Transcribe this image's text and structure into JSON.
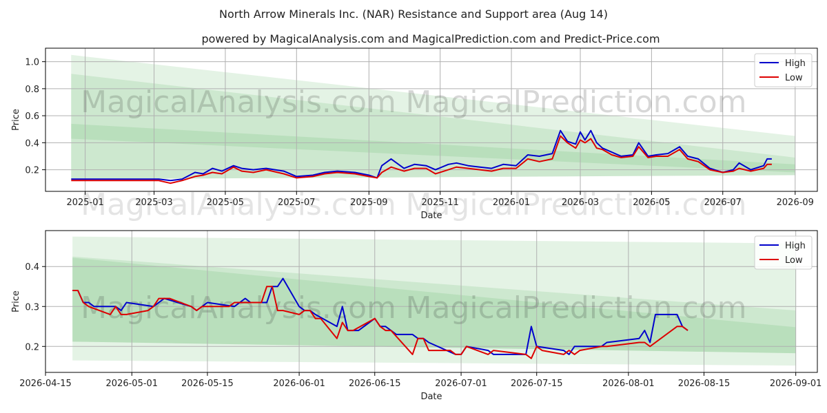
{
  "title": "North Arrow Minerals Inc. (NAR) Resistance and Support area (Aug 14)",
  "subtitle": "powered by MagicalAnalysis.com and MagicalPrediction.com and Predict-Price.com",
  "watermark_left": "MagicalAnalysis.com",
  "watermark_right": "MagicalPrediction.com",
  "colors": {
    "high": "#0000cc",
    "low": "#dd0000",
    "band": "#4caf50",
    "grid": "#b0b0b0"
  },
  "chart_data": [
    {
      "type": "line",
      "xlabel": "Date",
      "ylabel": "Price",
      "xlim": [
        "2024-11-28",
        "2026-09-20"
      ],
      "ylim": [
        0.04,
        1.1
      ],
      "x_ticks": [
        "2025-01",
        "2025-03",
        "2025-05",
        "2025-07",
        "2025-09",
        "2025-11",
        "2026-01",
        "2026-03",
        "2026-05",
        "2026-07",
        "2026-09"
      ],
      "x_tick_dates": [
        "2025-01-01",
        "2025-03-01",
        "2025-05-01",
        "2025-07-01",
        "2025-09-01",
        "2025-11-01",
        "2026-01-01",
        "2026-03-01",
        "2026-05-01",
        "2026-07-01",
        "2026-09-01"
      ],
      "y_ticks": [
        0.2,
        0.4,
        0.6,
        0.8,
        1.0
      ],
      "y_tick_labels": [
        "0.2",
        "0.4",
        "0.6",
        "0.8",
        "1.0"
      ],
      "grid": true,
      "legend": "top-right",
      "bands": [
        {
          "x": [
            "2024-12-20",
            "2026-09-01"
          ],
          "upper": [
            1.05,
            0.45
          ],
          "lower": [
            0.13,
            0.16
          ]
        },
        {
          "x": [
            "2024-12-20",
            "2026-09-01"
          ],
          "upper": [
            0.91,
            0.29
          ],
          "lower": [
            0.13,
            0.16
          ]
        },
        {
          "x": [
            "2024-12-20",
            "2026-09-01"
          ],
          "upper": [
            0.54,
            0.24
          ],
          "lower": [
            0.43,
            0.18
          ]
        }
      ],
      "series": [
        {
          "name": "High",
          "color": "#0000cc",
          "x": [
            "2024-12-20",
            "2025-01-05",
            "2025-01-20",
            "2025-02-05",
            "2025-02-20",
            "2025-03-05",
            "2025-03-15",
            "2025-03-25",
            "2025-04-05",
            "2025-04-12",
            "2025-04-20",
            "2025-04-28",
            "2025-05-08",
            "2025-05-15",
            "2025-05-25",
            "2025-06-05",
            "2025-06-20",
            "2025-07-01",
            "2025-07-15",
            "2025-07-25",
            "2025-08-05",
            "2025-08-20",
            "2025-09-01",
            "2025-09-08",
            "2025-09-12",
            "2025-09-20",
            "2025-10-01",
            "2025-10-10",
            "2025-10-20",
            "2025-10-28",
            "2025-11-08",
            "2025-11-15",
            "2025-11-25",
            "2025-12-05",
            "2025-12-15",
            "2025-12-25",
            "2026-01-05",
            "2026-01-15",
            "2026-01-25",
            "2026-02-05",
            "2026-02-12",
            "2026-02-18",
            "2026-02-25",
            "2026-03-01",
            "2026-03-05",
            "2026-03-10",
            "2026-03-15",
            "2026-03-20",
            "2026-03-28",
            "2026-04-05",
            "2026-04-15",
            "2026-04-20",
            "2026-04-28",
            "2026-05-05",
            "2026-05-15",
            "2026-05-25",
            "2026-06-01",
            "2026-06-10",
            "2026-06-20",
            "2026-07-01",
            "2026-07-10",
            "2026-07-15",
            "2026-07-25",
            "2026-08-05",
            "2026-08-08",
            "2026-08-12"
          ],
          "values": [
            0.13,
            0.13,
            0.13,
            0.13,
            0.13,
            0.13,
            0.12,
            0.13,
            0.18,
            0.17,
            0.21,
            0.19,
            0.23,
            0.21,
            0.2,
            0.21,
            0.19,
            0.15,
            0.16,
            0.18,
            0.19,
            0.18,
            0.16,
            0.14,
            0.23,
            0.28,
            0.21,
            0.24,
            0.23,
            0.2,
            0.24,
            0.25,
            0.23,
            0.22,
            0.21,
            0.24,
            0.23,
            0.31,
            0.3,
            0.32,
            0.49,
            0.41,
            0.39,
            0.48,
            0.42,
            0.49,
            0.4,
            0.36,
            0.33,
            0.3,
            0.31,
            0.4,
            0.3,
            0.31,
            0.32,
            0.37,
            0.3,
            0.28,
            0.21,
            0.18,
            0.2,
            0.25,
            0.2,
            0.23,
            0.28,
            0.28
          ]
        },
        {
          "name": "Low",
          "color": "#dd0000",
          "x": [
            "2024-12-20",
            "2025-01-05",
            "2025-01-20",
            "2025-02-05",
            "2025-02-20",
            "2025-03-05",
            "2025-03-15",
            "2025-03-25",
            "2025-04-05",
            "2025-04-12",
            "2025-04-20",
            "2025-04-28",
            "2025-05-08",
            "2025-05-15",
            "2025-05-25",
            "2025-06-05",
            "2025-06-20",
            "2025-07-01",
            "2025-07-15",
            "2025-07-25",
            "2025-08-05",
            "2025-08-20",
            "2025-09-01",
            "2025-09-08",
            "2025-09-12",
            "2025-09-20",
            "2025-10-01",
            "2025-10-10",
            "2025-10-20",
            "2025-10-28",
            "2025-11-08",
            "2025-11-15",
            "2025-11-25",
            "2025-12-05",
            "2025-12-15",
            "2025-12-25",
            "2026-01-05",
            "2026-01-15",
            "2026-01-25",
            "2026-02-05",
            "2026-02-12",
            "2026-02-18",
            "2026-02-25",
            "2026-03-01",
            "2026-03-05",
            "2026-03-10",
            "2026-03-15",
            "2026-03-20",
            "2026-03-28",
            "2026-04-05",
            "2026-04-15",
            "2026-04-20",
            "2026-04-28",
            "2026-05-05",
            "2026-05-15",
            "2026-05-25",
            "2026-06-01",
            "2026-06-10",
            "2026-06-20",
            "2026-07-01",
            "2026-07-10",
            "2026-07-15",
            "2026-07-25",
            "2026-08-05",
            "2026-08-08",
            "2026-08-12"
          ],
          "values": [
            0.12,
            0.12,
            0.12,
            0.12,
            0.12,
            0.12,
            0.1,
            0.12,
            0.15,
            0.16,
            0.18,
            0.17,
            0.22,
            0.19,
            0.18,
            0.2,
            0.17,
            0.14,
            0.15,
            0.17,
            0.18,
            0.17,
            0.15,
            0.14,
            0.18,
            0.22,
            0.19,
            0.21,
            0.21,
            0.17,
            0.2,
            0.22,
            0.21,
            0.2,
            0.19,
            0.21,
            0.21,
            0.28,
            0.26,
            0.28,
            0.45,
            0.4,
            0.36,
            0.42,
            0.4,
            0.43,
            0.36,
            0.35,
            0.31,
            0.29,
            0.3,
            0.37,
            0.29,
            0.3,
            0.3,
            0.35,
            0.28,
            0.26,
            0.2,
            0.18,
            0.19,
            0.21,
            0.19,
            0.21,
            0.24,
            0.24
          ]
        }
      ]
    },
    {
      "type": "line",
      "xlabel": "Date",
      "ylabel": "Price",
      "xlim": [
        "2026-04-15",
        "2026-09-05"
      ],
      "ylim": [
        0.135,
        0.49
      ],
      "x_ticks": [
        "2026-04-15",
        "2026-05-01",
        "2026-05-15",
        "2026-06-01",
        "2026-06-15",
        "2026-07-01",
        "2026-07-15",
        "2026-08-01",
        "2026-08-15",
        "2026-09-01"
      ],
      "y_ticks": [
        0.2,
        0.3,
        0.4
      ],
      "y_tick_labels": [
        "0.2",
        "0.3",
        "0.4"
      ],
      "grid": true,
      "legend": "top-right",
      "bands": [
        {
          "x": [
            "2026-04-20",
            "2026-09-01"
          ],
          "upper": [
            0.475,
            0.458
          ],
          "lower": [
            0.165,
            0.152
          ]
        },
        {
          "x": [
            "2026-04-20",
            "2026-09-01"
          ],
          "upper": [
            0.425,
            0.29
          ],
          "lower": [
            0.212,
            0.183
          ]
        },
        {
          "x": [
            "2026-04-20",
            "2026-09-01"
          ],
          "upper": [
            0.422,
            0.248
          ],
          "lower": [
            0.212,
            0.183
          ]
        }
      ],
      "series": [
        {
          "name": "High",
          "color": "#0000cc",
          "x": [
            "2026-04-20",
            "2026-04-21",
            "2026-04-22",
            "2026-04-23",
            "2026-04-24",
            "2026-04-28",
            "2026-04-29",
            "2026-04-30",
            "2026-05-05",
            "2026-05-07",
            "2026-05-12",
            "2026-05-13",
            "2026-05-15",
            "2026-05-20",
            "2026-05-22",
            "2026-05-23",
            "2026-05-26",
            "2026-05-27",
            "2026-05-28",
            "2026-05-29",
            "2026-06-01",
            "2026-06-02",
            "2026-06-03",
            "2026-06-04",
            "2026-06-08",
            "2026-06-09",
            "2026-06-10",
            "2026-06-11",
            "2026-06-12",
            "2026-06-15",
            "2026-06-16",
            "2026-06-17",
            "2026-06-18",
            "2026-06-19",
            "2026-06-22",
            "2026-06-23",
            "2026-06-24",
            "2026-06-25",
            "2026-06-30",
            "2026-07-01",
            "2026-07-02",
            "2026-07-06",
            "2026-07-07",
            "2026-07-12",
            "2026-07-13",
            "2026-07-14",
            "2026-07-15",
            "2026-07-20",
            "2026-07-21",
            "2026-07-22",
            "2026-07-27",
            "2026-07-28",
            "2026-08-03",
            "2026-08-04",
            "2026-08-05",
            "2026-08-06",
            "2026-08-10",
            "2026-08-11",
            "2026-08-12"
          ],
          "values": [
            0.34,
            0.34,
            0.31,
            0.31,
            0.3,
            0.3,
            0.29,
            0.31,
            0.3,
            0.32,
            0.3,
            0.29,
            0.31,
            0.3,
            0.32,
            0.31,
            0.31,
            0.35,
            0.35,
            0.37,
            0.3,
            0.29,
            0.29,
            0.28,
            0.25,
            0.3,
            0.24,
            0.24,
            0.24,
            0.27,
            0.25,
            0.25,
            0.24,
            0.23,
            0.23,
            0.22,
            0.22,
            0.21,
            0.18,
            0.18,
            0.2,
            0.19,
            0.18,
            0.18,
            0.18,
            0.25,
            0.2,
            0.19,
            0.18,
            0.2,
            0.2,
            0.21,
            0.22,
            0.24,
            0.21,
            0.28,
            0.28,
            0.25,
            0.24
          ]
        },
        {
          "name": "Low",
          "color": "#dd0000",
          "x": [
            "2026-04-20",
            "2026-04-21",
            "2026-04-22",
            "2026-04-23",
            "2026-04-27",
            "2026-04-28",
            "2026-04-29",
            "2026-04-30",
            "2026-05-04",
            "2026-05-05",
            "2026-05-06",
            "2026-05-07",
            "2026-05-08",
            "2026-05-12",
            "2026-05-13",
            "2026-05-14",
            "2026-05-19",
            "2026-05-20",
            "2026-05-25",
            "2026-05-26",
            "2026-05-27",
            "2026-05-28",
            "2026-05-29",
            "2026-06-01",
            "2026-06-02",
            "2026-06-03",
            "2026-06-04",
            "2026-06-05",
            "2026-06-08",
            "2026-06-09",
            "2026-06-10",
            "2026-06-11",
            "2026-06-15",
            "2026-06-16",
            "2026-06-17",
            "2026-06-18",
            "2026-06-22",
            "2026-06-23",
            "2026-06-24",
            "2026-06-25",
            "2026-06-29",
            "2026-06-30",
            "2026-07-01",
            "2026-07-02",
            "2026-07-06",
            "2026-07-07",
            "2026-07-13",
            "2026-07-14",
            "2026-07-15",
            "2026-07-16",
            "2026-07-20",
            "2026-07-21",
            "2026-07-22",
            "2026-07-23",
            "2026-07-27",
            "2026-07-28",
            "2026-08-03",
            "2026-08-04",
            "2026-08-05",
            "2026-08-10",
            "2026-08-11",
            "2026-08-12"
          ],
          "values": [
            0.34,
            0.34,
            0.31,
            0.3,
            0.28,
            0.3,
            0.28,
            0.28,
            0.29,
            0.3,
            0.32,
            0.32,
            0.32,
            0.3,
            0.29,
            0.3,
            0.3,
            0.31,
            0.31,
            0.35,
            0.35,
            0.29,
            0.29,
            0.28,
            0.29,
            0.29,
            0.27,
            0.27,
            0.22,
            0.26,
            0.24,
            0.24,
            0.27,
            0.25,
            0.24,
            0.24,
            0.18,
            0.22,
            0.22,
            0.19,
            0.19,
            0.18,
            0.18,
            0.2,
            0.18,
            0.19,
            0.18,
            0.17,
            0.2,
            0.19,
            0.18,
            0.19,
            0.18,
            0.19,
            0.2,
            0.2,
            0.21,
            0.21,
            0.2,
            0.25,
            0.25,
            0.24
          ]
        }
      ]
    }
  ]
}
